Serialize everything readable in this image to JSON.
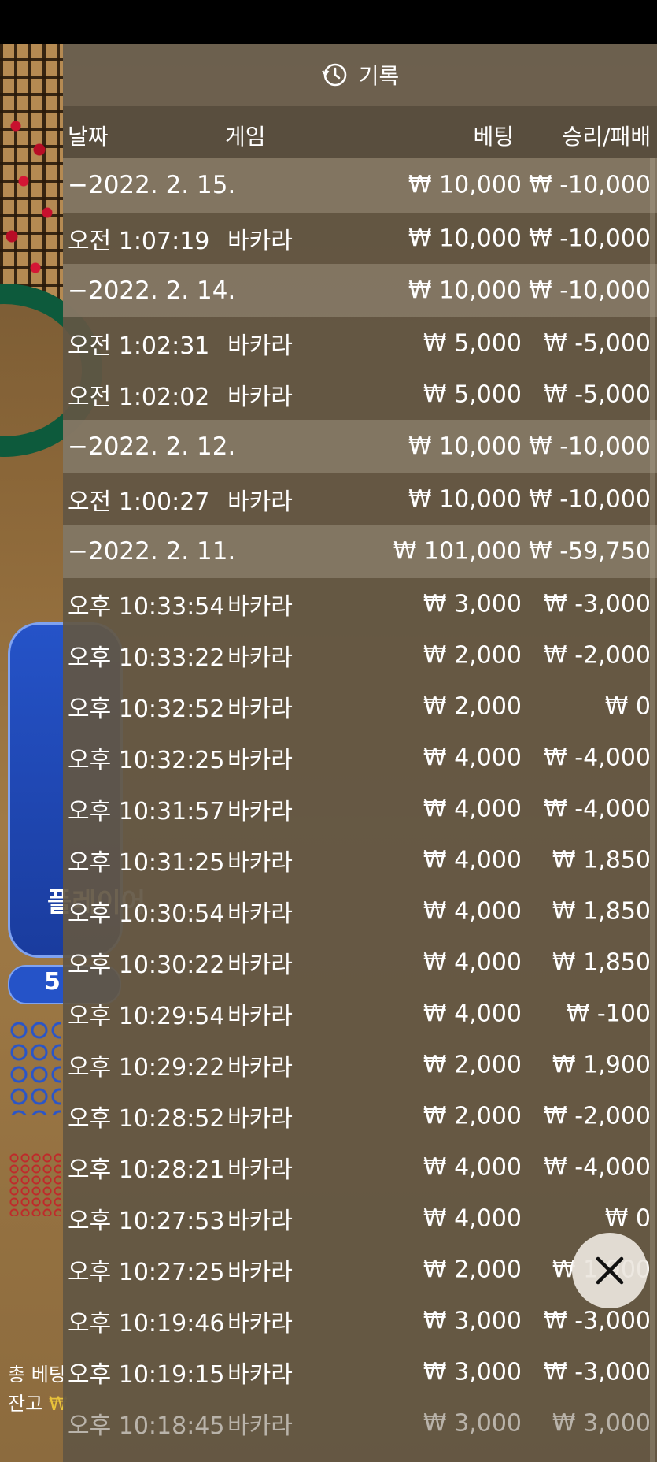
{
  "background": {
    "player_label": "플레이어",
    "pill_label": "5",
    "total_bet_label": "총 베팅",
    "balance_label": "잔고",
    "balance_currency": "₩"
  },
  "panel": {
    "title": "기록",
    "title_icon": "history-clock-icon",
    "columns": {
      "date": "날짜",
      "game": "게임",
      "bet": "베팅",
      "result": "승리/패배"
    },
    "rows": [
      {
        "type": "date",
        "date": "−2022. 2. 15.",
        "game": "",
        "bet": "₩ 10,000",
        "result": "₩ -10,000"
      },
      {
        "type": "entry",
        "date": "오전 1:07:19",
        "game": "바카라",
        "bet": "₩ 10,000",
        "result": "₩ -10,000"
      },
      {
        "type": "date",
        "date": "−2022. 2. 14.",
        "game": "",
        "bet": "₩ 10,000",
        "result": "₩ -10,000"
      },
      {
        "type": "entry",
        "date": "오전 1:02:31",
        "game": "바카라",
        "bet": "₩ 5,000",
        "result": "₩ -5,000"
      },
      {
        "type": "entry",
        "date": "오전 1:02:02",
        "game": "바카라",
        "bet": "₩ 5,000",
        "result": "₩ -5,000"
      },
      {
        "type": "date",
        "date": "−2022. 2. 12.",
        "game": "",
        "bet": "₩ 10,000",
        "result": "₩ -10,000"
      },
      {
        "type": "entry",
        "date": "오전 1:00:27",
        "game": "바카라",
        "bet": "₩ 10,000",
        "result": "₩ -10,000"
      },
      {
        "type": "date",
        "date": "−2022. 2. 11.",
        "game": "",
        "bet": "₩ 101,000",
        "result": "₩ -59,750"
      },
      {
        "type": "entry",
        "date": "오후 10:33:54",
        "game": "바카라",
        "bet": "₩ 3,000",
        "result": "₩ -3,000"
      },
      {
        "type": "entry",
        "date": "오후 10:33:22",
        "game": "바카라",
        "bet": "₩ 2,000",
        "result": "₩ -2,000"
      },
      {
        "type": "entry",
        "date": "오후 10:32:52",
        "game": "바카라",
        "bet": "₩ 2,000",
        "result": "₩ 0"
      },
      {
        "type": "entry",
        "date": "오후 10:32:25",
        "game": "바카라",
        "bet": "₩ 4,000",
        "result": "₩ -4,000"
      },
      {
        "type": "entry",
        "date": "오후 10:31:57",
        "game": "바카라",
        "bet": "₩ 4,000",
        "result": "₩ -4,000"
      },
      {
        "type": "entry",
        "date": "오후 10:31:25",
        "game": "바카라",
        "bet": "₩ 4,000",
        "result": "₩ 1,850"
      },
      {
        "type": "entry",
        "date": "오후 10:30:54",
        "game": "바카라",
        "bet": "₩ 4,000",
        "result": "₩ 1,850"
      },
      {
        "type": "entry",
        "date": "오후 10:30:22",
        "game": "바카라",
        "bet": "₩ 4,000",
        "result": "₩ 1,850"
      },
      {
        "type": "entry",
        "date": "오후 10:29:54",
        "game": "바카라",
        "bet": "₩ 4,000",
        "result": "₩ -100"
      },
      {
        "type": "entry",
        "date": "오후 10:29:22",
        "game": "바카라",
        "bet": "₩ 2,000",
        "result": "₩ 1,900"
      },
      {
        "type": "entry",
        "date": "오후 10:28:52",
        "game": "바카라",
        "bet": "₩ 2,000",
        "result": "₩ -2,000"
      },
      {
        "type": "entry",
        "date": "오후 10:28:21",
        "game": "바카라",
        "bet": "₩ 4,000",
        "result": "₩ -4,000"
      },
      {
        "type": "entry",
        "date": "오후 10:27:53",
        "game": "바카라",
        "bet": "₩ 4,000",
        "result": "₩ 0"
      },
      {
        "type": "entry",
        "date": "오후 10:27:25",
        "game": "바카라",
        "bet": "₩ 2,000",
        "result": "₩ 1,900"
      },
      {
        "type": "entry",
        "date": "오후 10:19:46",
        "game": "바카라",
        "bet": "₩ 3,000",
        "result": "₩ -3,000"
      },
      {
        "type": "entry",
        "date": "오후 10:19:15",
        "game": "바카라",
        "bet": "₩ 3,000",
        "result": "₩ -3,000"
      },
      {
        "type": "entry",
        "date": "오후 10:18:45",
        "game": "바카라",
        "bet": "₩ 3,000",
        "result": "₩ 3,000",
        "faded": true
      }
    ],
    "close_icon": "close-icon"
  }
}
